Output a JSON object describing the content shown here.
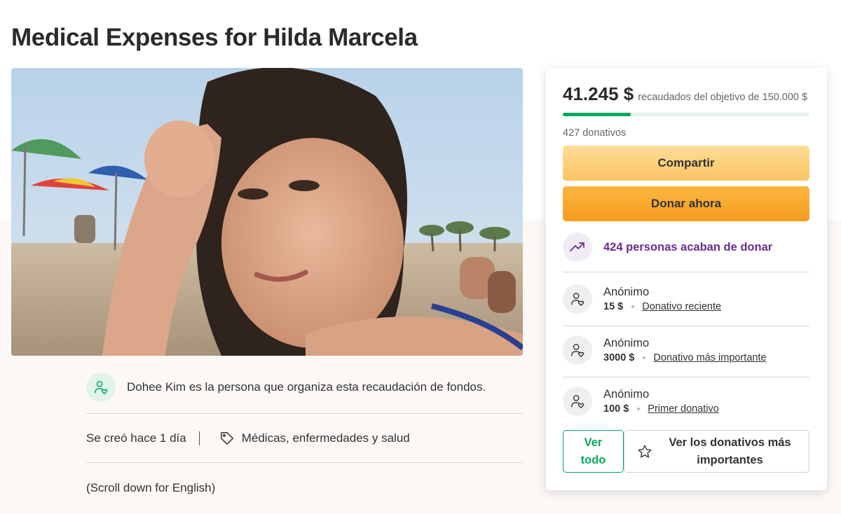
{
  "campaign": {
    "title": "Medical Expenses for Hilda Marcela",
    "organizer_text": "Dohee Kim es la persona que organiza esta recaudación de fondos.",
    "created": "Se creó hace 1 día",
    "category": "Médicas, enfermedades y salud",
    "scroll_note": "(Scroll down for English)"
  },
  "donation_card": {
    "raised_amount": "41.245 $",
    "goal_text": "recaudados del objetivo de 150.000 $",
    "progress_fraction": 0.275,
    "donation_count": "427 donativos",
    "share_label": "Compartir",
    "donate_label": "Donar ahora",
    "recent_activity": "424 personas acaban de donar",
    "donors": [
      {
        "name": "Anónimo",
        "amount": "15 $",
        "type": "Donativo reciente"
      },
      {
        "name": "Anónimo",
        "amount": "3000 $",
        "type": "Donativo más importante"
      },
      {
        "name": "Anónimo",
        "amount": "100 $",
        "type": "Primer donativo"
      }
    ],
    "see_all_label": "Ver todo",
    "top_donations_label": "Ver los donativos más importantes"
  },
  "colors": {
    "brand_green": "#02a95c",
    "donate_orange": "#f59c1f",
    "share_yellow": "#fbc563",
    "activity_purple": "#6c2b90"
  },
  "icons": [
    "organizer-heart-icon",
    "tag-icon",
    "trending-up-icon",
    "donor-heart-icon",
    "star-icon"
  ]
}
